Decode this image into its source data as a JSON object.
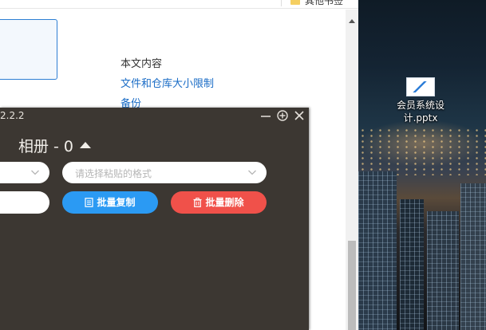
{
  "browser": {
    "bookmark_folder": "其他书签",
    "toc": {
      "heading": "本文内容",
      "links": [
        "文件和仓库大小限制",
        "备份"
      ]
    }
  },
  "desktop": {
    "file_icon": {
      "label": "会员系统设计.pptx",
      "icon": "pptx-file-icon"
    }
  },
  "app": {
    "version": "2.2.2",
    "album_title": "相册 - 0",
    "format_select_placeholder": "请选择粘贴的格式",
    "buttons": {
      "batch_copy": "批量复制",
      "batch_delete": "批量删除"
    },
    "colors": {
      "panel_bg": "#3c3732",
      "copy_button": "#2b9af3",
      "delete_button": "#f0514a",
      "link": "#1a6cc6"
    }
  }
}
